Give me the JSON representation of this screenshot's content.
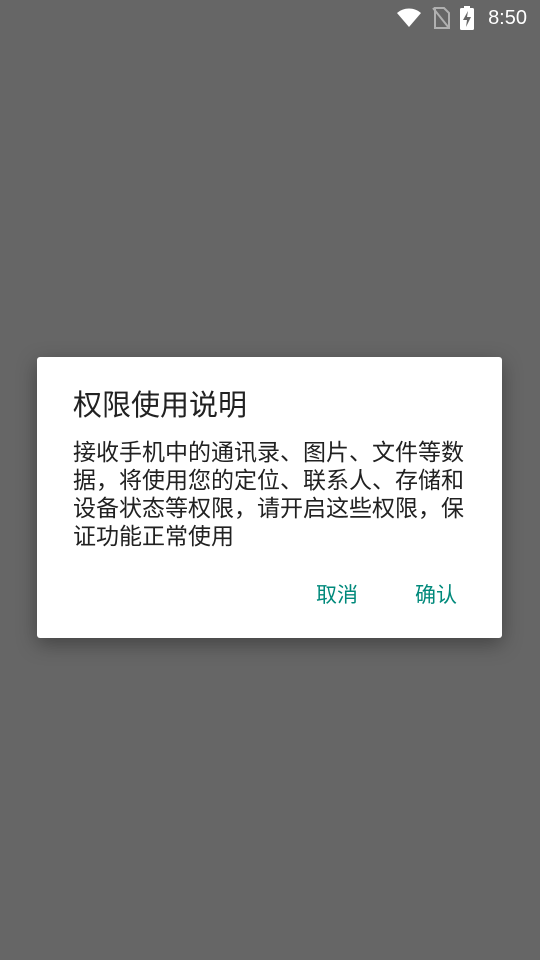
{
  "status_bar": {
    "time": "8:50",
    "icons": [
      "wifi-icon",
      "no-sim-icon",
      "battery-charging-icon"
    ]
  },
  "dialog": {
    "title": "权限使用说明",
    "message": "接收手机中的通讯录、图片、文件等数据，将使用您的定位、联系人、存储和设备状态等权限，请开启这些权限，保证功能正常使用",
    "cancel_label": "取消",
    "confirm_label": "确认"
  },
  "colors": {
    "accent": "#00897b",
    "backdrop": "#666666"
  }
}
